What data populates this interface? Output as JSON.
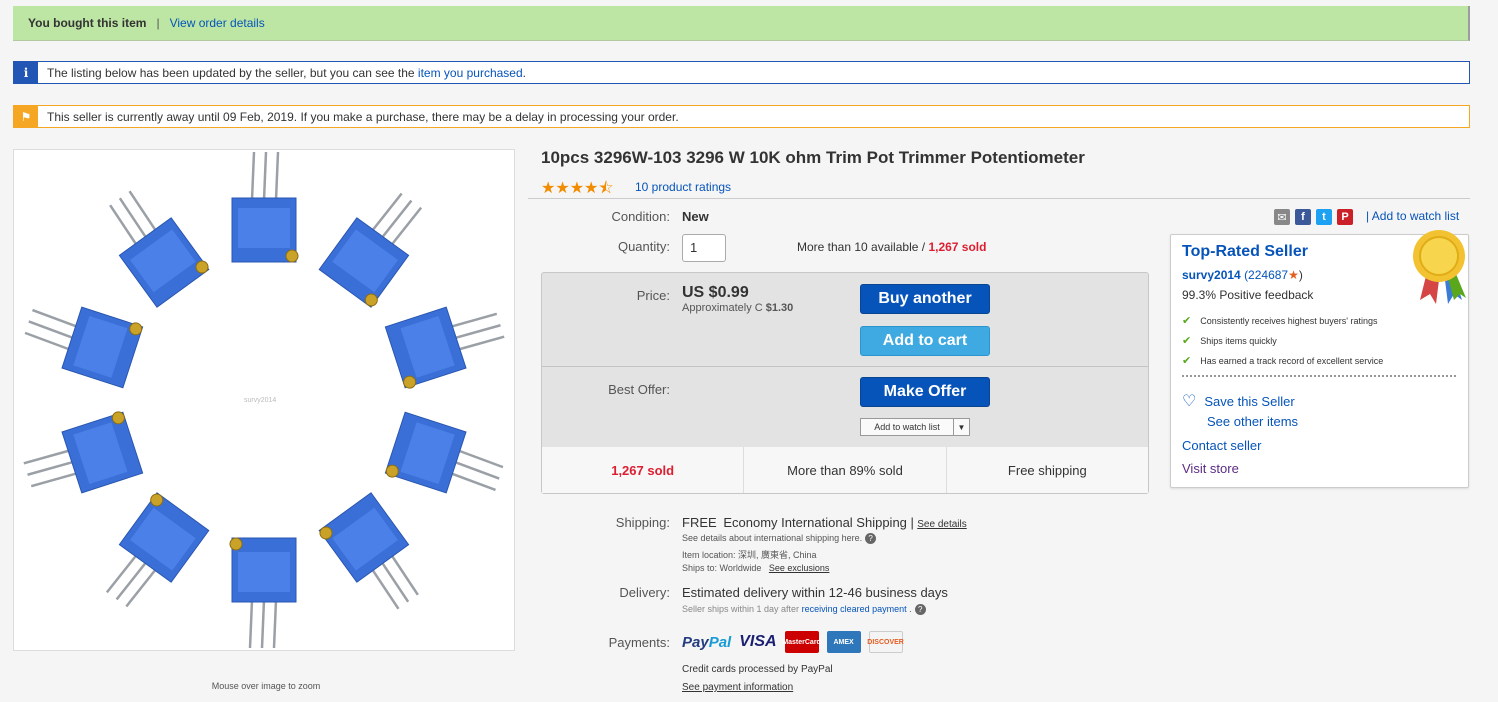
{
  "banner": {
    "bought": "You bought this item",
    "separator": "|",
    "view_order": "View order details"
  },
  "info_msg": {
    "text": "The listing below has been updated by the seller, but you can see the ",
    "link": "item you purchased",
    "tail": "."
  },
  "warn_msg": {
    "text": "This seller is currently away until 09 Feb, 2019. If you make a purchase, there may be a delay in processing your order."
  },
  "image": {
    "watermark": "survy2014",
    "zoom_hint": "Mouse over image to zoom"
  },
  "product": {
    "title": "10pcs 3296W-103 3296 W 10K ohm Trim Pot Trimmer Potentiometer",
    "rating_stars": 4.5,
    "ratings_link": "10 product ratings",
    "condition_label": "Condition:",
    "condition": "New",
    "quantity_label": "Quantity:",
    "quantity": "1",
    "available": "More than 10 available /",
    "sold": "1,267 sold"
  },
  "watch_top": "Add to watch list",
  "price": {
    "label": "Price:",
    "value": "US $0.99",
    "approx_prefix": "Approximately C",
    "approx_value": "$1.30",
    "buy_another": "Buy another",
    "add_to_cart": "Add to cart",
    "best_offer_label": "Best Offer:",
    "make_offer": "Make Offer",
    "watch_dd": "Add to watch list"
  },
  "stats": {
    "sold": "1,267 sold",
    "percent": "More than 89% sold",
    "shipping": "Free shipping"
  },
  "shipping": {
    "label": "Shipping:",
    "free": "FREE",
    "method": "Economy International Shipping |",
    "see_details": "See details",
    "intl_note": "See details about international shipping here.",
    "location": "Item location:  深圳, 廣東省, China",
    "ships_to": "Ships to:  Worldwide",
    "see_exclusions": "See exclusions"
  },
  "delivery": {
    "label": "Delivery:",
    "estimate": "Estimated delivery within 12-46 business days",
    "note": "Seller ships within 1 day after",
    "note_link": "receiving cleared payment",
    "note_tail": "."
  },
  "payments": {
    "label": "Payments:",
    "paypal_a": "Pay",
    "paypal_b": "Pal",
    "visa": "VISA",
    "mastercard": "MasterCard",
    "amex": "AMEX",
    "discover": "DISCOVER",
    "processed": "Credit cards processed by PayPal",
    "info_link": "See payment information"
  },
  "seller": {
    "title": "Top-Rated Seller",
    "name": "survy2014",
    "score": "(224687",
    "score_tail": ")",
    "feedback": "99.3% Positive feedback",
    "points": [
      "Consistently receives highest buyers' ratings",
      "Ships items quickly",
      "Has earned a track record of excellent service"
    ],
    "save": "Save this Seller",
    "other": "See other items",
    "contact": "Contact seller",
    "visit": "Visit store"
  },
  "colors": {
    "brand_blue": "#0654ba",
    "sold_red": "#dd1e31",
    "star_orange": "#f18c00",
    "success_green": "#bde6a4"
  }
}
